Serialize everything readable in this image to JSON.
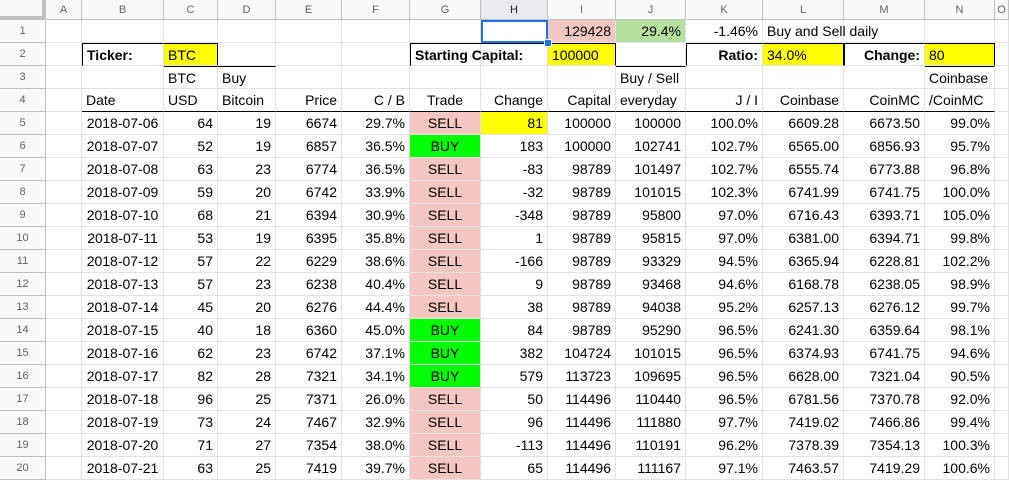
{
  "columns": [
    "A",
    "B",
    "C",
    "D",
    "E",
    "F",
    "G",
    "H",
    "I",
    "J",
    "K",
    "L",
    "M",
    "N",
    "O"
  ],
  "selected_column": "H",
  "row1": {
    "I": "129428",
    "J": "29.4%",
    "K": "-1.46%",
    "L": "Buy and Sell daily"
  },
  "row2": {
    "ticker_label": "Ticker:",
    "ticker_value": "BTC",
    "capital_label": "Starting Capital:",
    "capital_value": "100000",
    "ratio_label": "Ratio:",
    "ratio_value": "34.0%",
    "change_label": "Change:",
    "change_value": "80"
  },
  "headers3": {
    "C": "BTC",
    "D": "Buy",
    "J": "Buy / Sell",
    "N": "Coinbase"
  },
  "headers4": {
    "B": "Date",
    "C": "USD",
    "D": "Bitcoin",
    "E": "Price",
    "F": "C / B",
    "G": "Trade",
    "H": "Change",
    "I": "Capital",
    "J": "everyday",
    "K": "J / I",
    "L": "Coinbase",
    "M": "CoinMC",
    "N": "/CoinMC"
  },
  "rows": [
    {
      "n": "5",
      "date": "2018-07-06",
      "usd": "64",
      "btc": "19",
      "price": "6674",
      "cb": "29.7%",
      "trade": "SELL",
      "change": "81",
      "capital": "100000",
      "bs": "100000",
      "ji": "100.0%",
      "coinbase": "6609.28",
      "coinmc": "6673.50",
      "ratio": "99.0%"
    },
    {
      "n": "6",
      "date": "2018-07-07",
      "usd": "52",
      "btc": "19",
      "price": "6857",
      "cb": "36.5%",
      "trade": "BUY",
      "change": "183",
      "capital": "100000",
      "bs": "102741",
      "ji": "102.7%",
      "coinbase": "6565.00",
      "coinmc": "6856.93",
      "ratio": "95.7%"
    },
    {
      "n": "7",
      "date": "2018-07-08",
      "usd": "63",
      "btc": "23",
      "price": "6774",
      "cb": "36.5%",
      "trade": "SELL",
      "change": "-83",
      "capital": "98789",
      "bs": "101497",
      "ji": "102.7%",
      "coinbase": "6555.74",
      "coinmc": "6773.88",
      "ratio": "96.8%"
    },
    {
      "n": "8",
      "date": "2018-07-09",
      "usd": "59",
      "btc": "20",
      "price": "6742",
      "cb": "33.9%",
      "trade": "SELL",
      "change": "-32",
      "capital": "98789",
      "bs": "101015",
      "ji": "102.3%",
      "coinbase": "6741.99",
      "coinmc": "6741.75",
      "ratio": "100.0%"
    },
    {
      "n": "9",
      "date": "2018-07-10",
      "usd": "68",
      "btc": "21",
      "price": "6394",
      "cb": "30.9%",
      "trade": "SELL",
      "change": "-348",
      "capital": "98789",
      "bs": "95800",
      "ji": "97.0%",
      "coinbase": "6716.43",
      "coinmc": "6393.71",
      "ratio": "105.0%"
    },
    {
      "n": "10",
      "date": "2018-07-11",
      "usd": "53",
      "btc": "19",
      "price": "6395",
      "cb": "35.8%",
      "trade": "SELL",
      "change": "1",
      "capital": "98789",
      "bs": "95815",
      "ji": "97.0%",
      "coinbase": "6381.00",
      "coinmc": "6394.71",
      "ratio": "99.8%"
    },
    {
      "n": "11",
      "date": "2018-07-12",
      "usd": "57",
      "btc": "22",
      "price": "6229",
      "cb": "38.6%",
      "trade": "SELL",
      "change": "-166",
      "capital": "98789",
      "bs": "93329",
      "ji": "94.5%",
      "coinbase": "6365.94",
      "coinmc": "6228.81",
      "ratio": "102.2%"
    },
    {
      "n": "12",
      "date": "2018-07-13",
      "usd": "57",
      "btc": "23",
      "price": "6238",
      "cb": "40.4%",
      "trade": "SELL",
      "change": "9",
      "capital": "98789",
      "bs": "93468",
      "ji": "94.6%",
      "coinbase": "6168.78",
      "coinmc": "6238.05",
      "ratio": "98.9%"
    },
    {
      "n": "13",
      "date": "2018-07-14",
      "usd": "45",
      "btc": "20",
      "price": "6276",
      "cb": "44.4%",
      "trade": "SELL",
      "change": "38",
      "capital": "98789",
      "bs": "94038",
      "ji": "95.2%",
      "coinbase": "6257.13",
      "coinmc": "6276.12",
      "ratio": "99.7%"
    },
    {
      "n": "14",
      "date": "2018-07-15",
      "usd": "40",
      "btc": "18",
      "price": "6360",
      "cb": "45.0%",
      "trade": "BUY",
      "change": "84",
      "capital": "98789",
      "bs": "95290",
      "ji": "96.5%",
      "coinbase": "6241.30",
      "coinmc": "6359.64",
      "ratio": "98.1%"
    },
    {
      "n": "15",
      "date": "2018-07-16",
      "usd": "62",
      "btc": "23",
      "price": "6742",
      "cb": "37.1%",
      "trade": "BUY",
      "change": "382",
      "capital": "104724",
      "bs": "101015",
      "ji": "96.5%",
      "coinbase": "6374.93",
      "coinmc": "6741.75",
      "ratio": "94.6%"
    },
    {
      "n": "16",
      "date": "2018-07-17",
      "usd": "82",
      "btc": "28",
      "price": "7321",
      "cb": "34.1%",
      "trade": "BUY",
      "change": "579",
      "capital": "113723",
      "bs": "109695",
      "ji": "96.5%",
      "coinbase": "6628.00",
      "coinmc": "7321.04",
      "ratio": "90.5%"
    },
    {
      "n": "17",
      "date": "2018-07-18",
      "usd": "96",
      "btc": "25",
      "price": "7371",
      "cb": "26.0%",
      "trade": "SELL",
      "change": "50",
      "capital": "114496",
      "bs": "110440",
      "ji": "96.5%",
      "coinbase": "6781.56",
      "coinmc": "7370.78",
      "ratio": "92.0%"
    },
    {
      "n": "18",
      "date": "2018-07-19",
      "usd": "73",
      "btc": "24",
      "price": "7467",
      "cb": "32.9%",
      "trade": "SELL",
      "change": "96",
      "capital": "114496",
      "bs": "111880",
      "ji": "97.7%",
      "coinbase": "7419.02",
      "coinmc": "7466.86",
      "ratio": "99.4%"
    },
    {
      "n": "19",
      "date": "2018-07-20",
      "usd": "71",
      "btc": "27",
      "price": "7354",
      "cb": "38.0%",
      "trade": "SELL",
      "change": "-113",
      "capital": "114496",
      "bs": "110191",
      "ji": "96.2%",
      "coinbase": "7378.39",
      "coinmc": "7354.13",
      "ratio": "100.3%"
    },
    {
      "n": "20",
      "date": "2018-07-21",
      "usd": "63",
      "btc": "25",
      "price": "7419",
      "cb": "39.7%",
      "trade": "SELL",
      "change": "65",
      "capital": "114496",
      "bs": "111167",
      "ji": "97.1%",
      "coinbase": "7463.57",
      "coinmc": "7419.29",
      "ratio": "100.6%"
    }
  ],
  "colors": {
    "sell": "#f4c7c3",
    "buy": "#00ff00",
    "highlight": "#ffff00",
    "profit": "#f4c7c3",
    "percent": "#b7e1a1",
    "selection": "#1a73e8"
  }
}
